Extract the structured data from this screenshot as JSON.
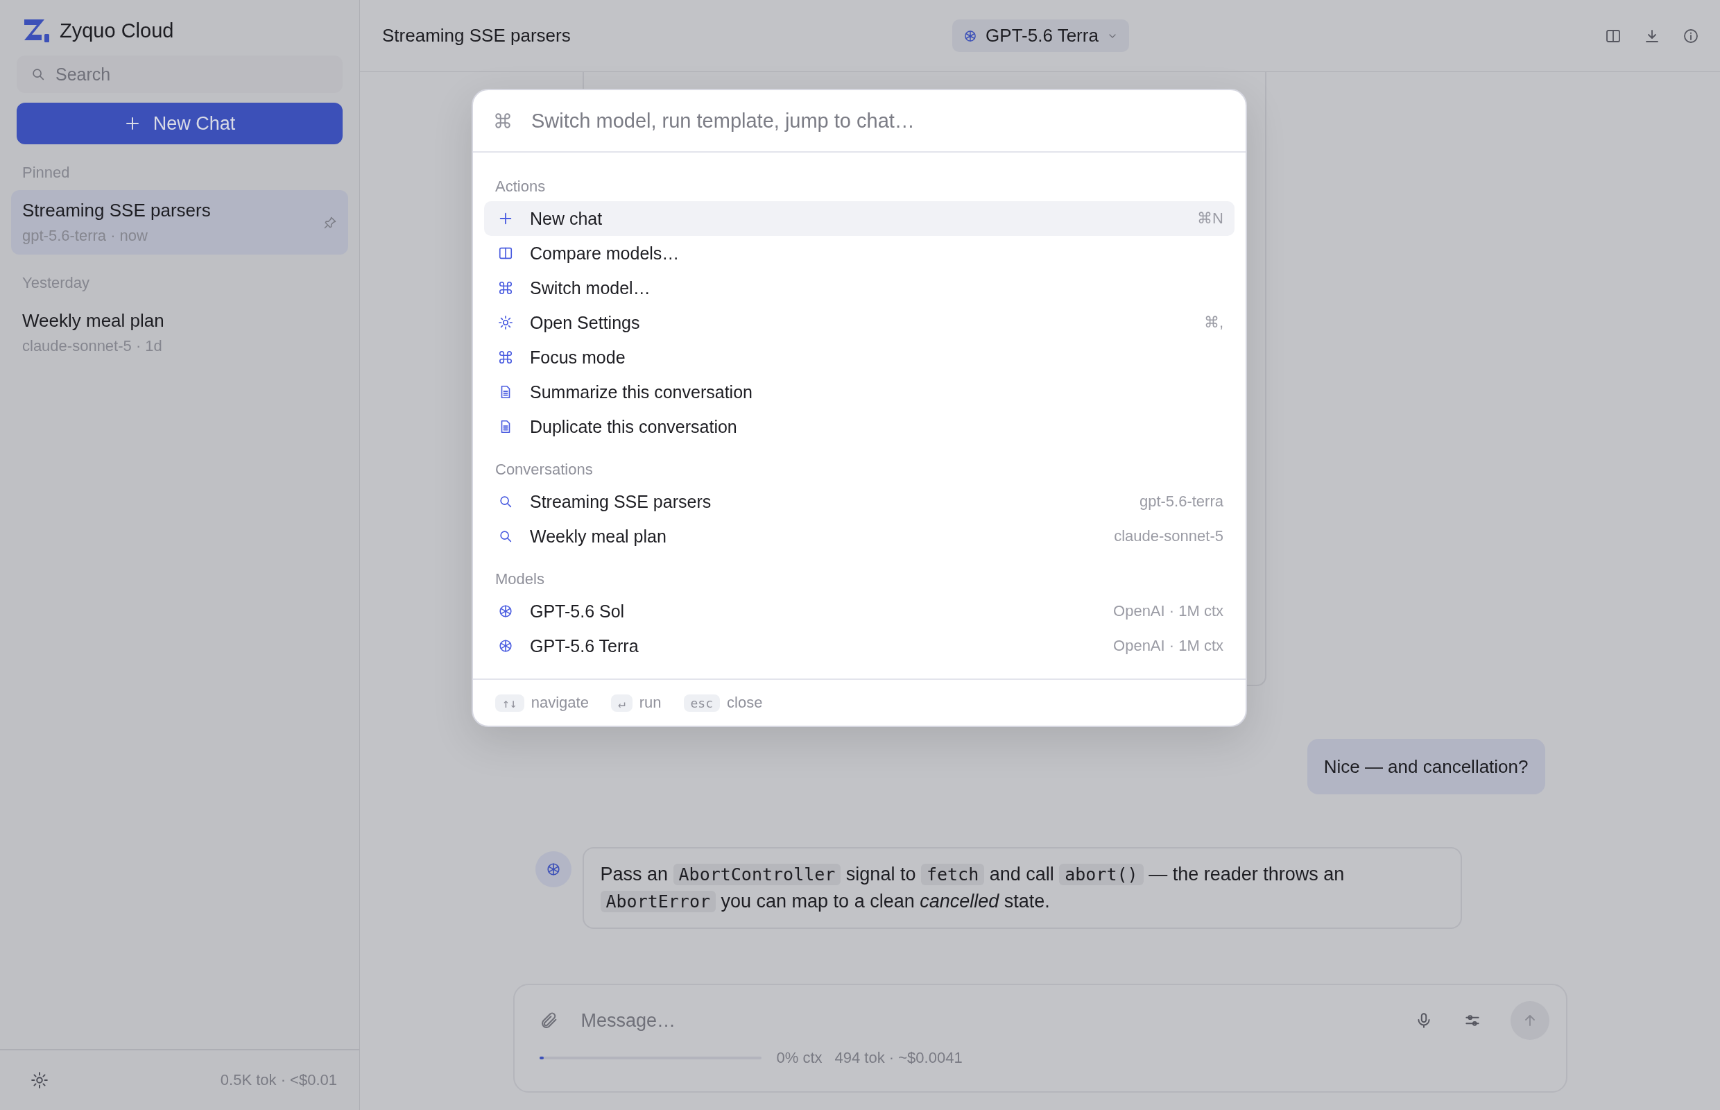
{
  "sidebar": {
    "brand": "Zyquo Cloud",
    "search": {
      "placeholder": "Search"
    },
    "new_chat": "New Chat",
    "groups": [
      {
        "label": "Pinned",
        "items": [
          {
            "title": "Streaming SSE parsers",
            "meta": "gpt-5.6-terra · now",
            "selected": true,
            "pinned": true
          }
        ]
      },
      {
        "label": "Yesterday",
        "items": [
          {
            "title": "Weekly meal plan",
            "meta": "claude-sonnet-5 · 1d",
            "selected": false,
            "pinned": false
          }
        ]
      }
    ],
    "footer": "0.5K tok · <$0.01"
  },
  "header": {
    "title": "Streaming SSE parsers",
    "model": "GPT-5.6 Terra"
  },
  "messages": [
    {
      "kind": "user",
      "parts": [
        {
          "kind": "text",
          "text": "Nice — and cancellation?"
        }
      ]
    },
    {
      "kind": "assistant",
      "parts": [
        {
          "kind": "text",
          "text": "Pass an "
        },
        {
          "kind": "code",
          "text": "AbortController"
        },
        {
          "kind": "text",
          "text": " signal to "
        },
        {
          "kind": "code",
          "text": "fetch"
        },
        {
          "kind": "text",
          "text": " and call "
        },
        {
          "kind": "code",
          "text": "abort()"
        },
        {
          "kind": "text",
          "text": " — the reader throws an "
        },
        {
          "kind": "code",
          "text": "AbortError"
        },
        {
          "kind": "text",
          "text": " you can map to a clean *cancelled* state."
        }
      ]
    }
  ],
  "composer": {
    "placeholder": "Message…",
    "level": 0,
    "reading": "0% ctx",
    "usage": "494 tok · ~$0.0041"
  },
  "palette": {
    "placeholder": "Switch model, run template, jump to chat…",
    "sections": [
      {
        "label": "Actions",
        "items": [
          {
            "kind": "plus",
            "label": "New chat",
            "detail": "⌘N",
            "selected": true
          },
          {
            "kind": "columns",
            "label": "Compare models…",
            "selected": false
          },
          {
            "kind": "command",
            "label": "Switch model…",
            "selected": false
          },
          {
            "kind": "sun",
            "label": "Open Settings",
            "detail": "⌘,",
            "selected": false
          },
          {
            "kind": "command",
            "label": "Focus mode",
            "selected": false
          },
          {
            "kind": "doc",
            "label": "Summarize this conversation",
            "selected": false
          },
          {
            "kind": "doc",
            "label": "Duplicate this conversation",
            "selected": false
          }
        ]
      },
      {
        "label": "Conversations",
        "items": [
          {
            "kind": "search",
            "label": "Streaming SSE parsers",
            "detail": "gpt-5.6-terra",
            "selected": false
          },
          {
            "kind": "search",
            "label": "Weekly meal plan",
            "detail": "claude-sonnet-5",
            "selected": false
          }
        ]
      },
      {
        "label": "Models",
        "items": [
          {
            "kind": "model",
            "label": "GPT-5.6 Sol",
            "detail": "OpenAI · 1M ctx",
            "selected": false
          },
          {
            "kind": "model",
            "label": "GPT-5.6 Terra",
            "detail": "OpenAI · 1M ctx",
            "selected": false
          }
        ]
      }
    ],
    "hints": [
      {
        "key": "↑↓",
        "label": "navigate"
      },
      {
        "key": "↵",
        "label": "run"
      },
      {
        "key": "esc",
        "label": "close"
      }
    ]
  }
}
